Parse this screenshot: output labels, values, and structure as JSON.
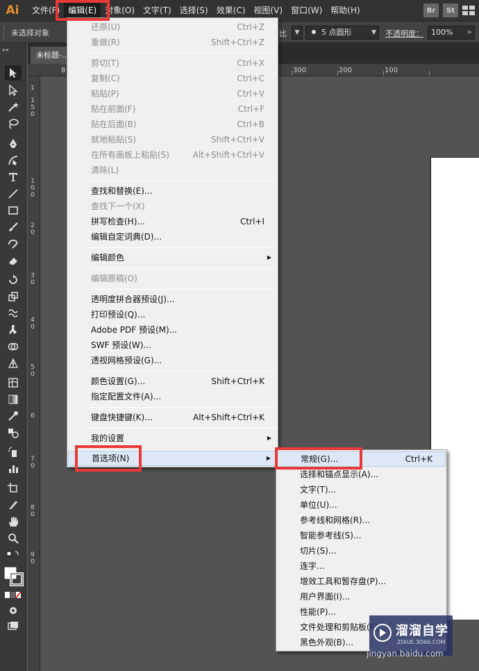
{
  "app": {
    "logo": "Ai"
  },
  "menubar": {
    "items": [
      "文件(F)",
      "编辑(E)",
      "对象(O)",
      "文字(T)",
      "选择(S)",
      "效果(C)",
      "视图(V)",
      "窗口(W)",
      "帮助(H)"
    ],
    "open_item": "编辑(E)",
    "app_buttons": [
      "Br",
      "St"
    ]
  },
  "controlbar": {
    "selection_status": "未选择对象",
    "ratio_label_partial": "比",
    "brush_dot_size": "5",
    "brush_name": "点圆形",
    "opacity_label": "不透明度：",
    "opacity_value": "100%"
  },
  "document_tab": {
    "title": "未标题-..."
  },
  "ruler_top": {
    "labels": [
      "8",
      "300",
      "200",
      "100"
    ]
  },
  "ruler_left": {
    "labels": [
      "1",
      "1 5 0",
      "1 0 0",
      "2 0",
      "3 0",
      "4 0",
      "5 0",
      "6",
      "7 0",
      "8 0",
      "9 0"
    ]
  },
  "edit_menu": {
    "items": [
      {
        "label": "还原(U)",
        "shortcut": "Ctrl+Z",
        "disabled": true
      },
      {
        "label": "重做(R)",
        "shortcut": "Shift+Ctrl+Z",
        "disabled": true
      },
      {
        "label": "剪切(T)",
        "shortcut": "Ctrl+X",
        "disabled": true
      },
      {
        "label": "复制(C)",
        "shortcut": "Ctrl+C",
        "disabled": true
      },
      {
        "label": "粘贴(P)",
        "shortcut": "Ctrl+V",
        "disabled": true
      },
      {
        "label": "贴在前面(F)",
        "shortcut": "Ctrl+F",
        "disabled": true
      },
      {
        "label": "贴在后面(B)",
        "shortcut": "Ctrl+B",
        "disabled": true
      },
      {
        "label": "就地粘贴(S)",
        "shortcut": "Shift+Ctrl+V",
        "disabled": true
      },
      {
        "label": "在所有画板上粘贴(S)",
        "shortcut": "Alt+Shift+Ctrl+V",
        "disabled": true
      },
      {
        "label": "清除(L)",
        "shortcut": "",
        "disabled": true
      },
      {
        "label": "查找和替换(E)...",
        "shortcut": "",
        "disabled": false
      },
      {
        "label": "查找下一个(X)",
        "shortcut": "",
        "disabled": true
      },
      {
        "label": "拼写检查(H)...",
        "shortcut": "Ctrl+I",
        "disabled": false
      },
      {
        "label": "编辑自定词典(D)...",
        "shortcut": "",
        "disabled": false
      },
      {
        "label": "编辑颜色",
        "shortcut": "",
        "disabled": false,
        "submenu": true
      },
      {
        "label": "编辑原稿(O)",
        "shortcut": "",
        "disabled": true
      },
      {
        "label": "透明度拼合器预设(J)...",
        "shortcut": "",
        "disabled": false
      },
      {
        "label": "打印预设(Q)...",
        "shortcut": "",
        "disabled": false
      },
      {
        "label": "Adobe PDF 预设(M)...",
        "shortcut": "",
        "disabled": false
      },
      {
        "label": "SWF 预设(W)...",
        "shortcut": "",
        "disabled": false
      },
      {
        "label": "透视网格预设(G)...",
        "shortcut": "",
        "disabled": false
      },
      {
        "label": "颜色设置(G)...",
        "shortcut": "Shift+Ctrl+K",
        "disabled": false
      },
      {
        "label": "指定配置文件(A)...",
        "shortcut": "",
        "disabled": false
      },
      {
        "label": "键盘快捷键(K)...",
        "shortcut": "Alt+Shift+Ctrl+K",
        "disabled": false
      },
      {
        "label": "我的设置",
        "shortcut": "",
        "disabled": false,
        "submenu": true
      },
      {
        "label": "首选项(N)",
        "shortcut": "",
        "disabled": false,
        "submenu": true,
        "highlighted": true
      }
    ]
  },
  "prefs_menu": {
    "items": [
      {
        "label": "常规(G)...",
        "shortcut": "Ctrl+K",
        "highlighted": true
      },
      {
        "label": "选择和锚点显示(A)...",
        "shortcut": ""
      },
      {
        "label": "文字(T)...",
        "shortcut": ""
      },
      {
        "label": "单位(U)...",
        "shortcut": ""
      },
      {
        "label": "参考线和网格(R)...",
        "shortcut": ""
      },
      {
        "label": "智能参考线(S)...",
        "shortcut": ""
      },
      {
        "label": "切片(S)...",
        "shortcut": ""
      },
      {
        "label": "连字...",
        "shortcut": ""
      },
      {
        "label": "增效工具和暂存盘(P)...",
        "shortcut": ""
      },
      {
        "label": "用户界面(I)...",
        "shortcut": ""
      },
      {
        "label": "性能(P)...",
        "shortcut": ""
      },
      {
        "label": "文件处理和剪贴板(F)...",
        "shortcut": ""
      },
      {
        "label": "黑色外观(B)...",
        "shortcut": ""
      }
    ]
  },
  "watermark": {
    "title": "溜溜自学",
    "subtitle": "ZIXUE.3D66.COM",
    "url": "jingyan.baidu.com"
  }
}
